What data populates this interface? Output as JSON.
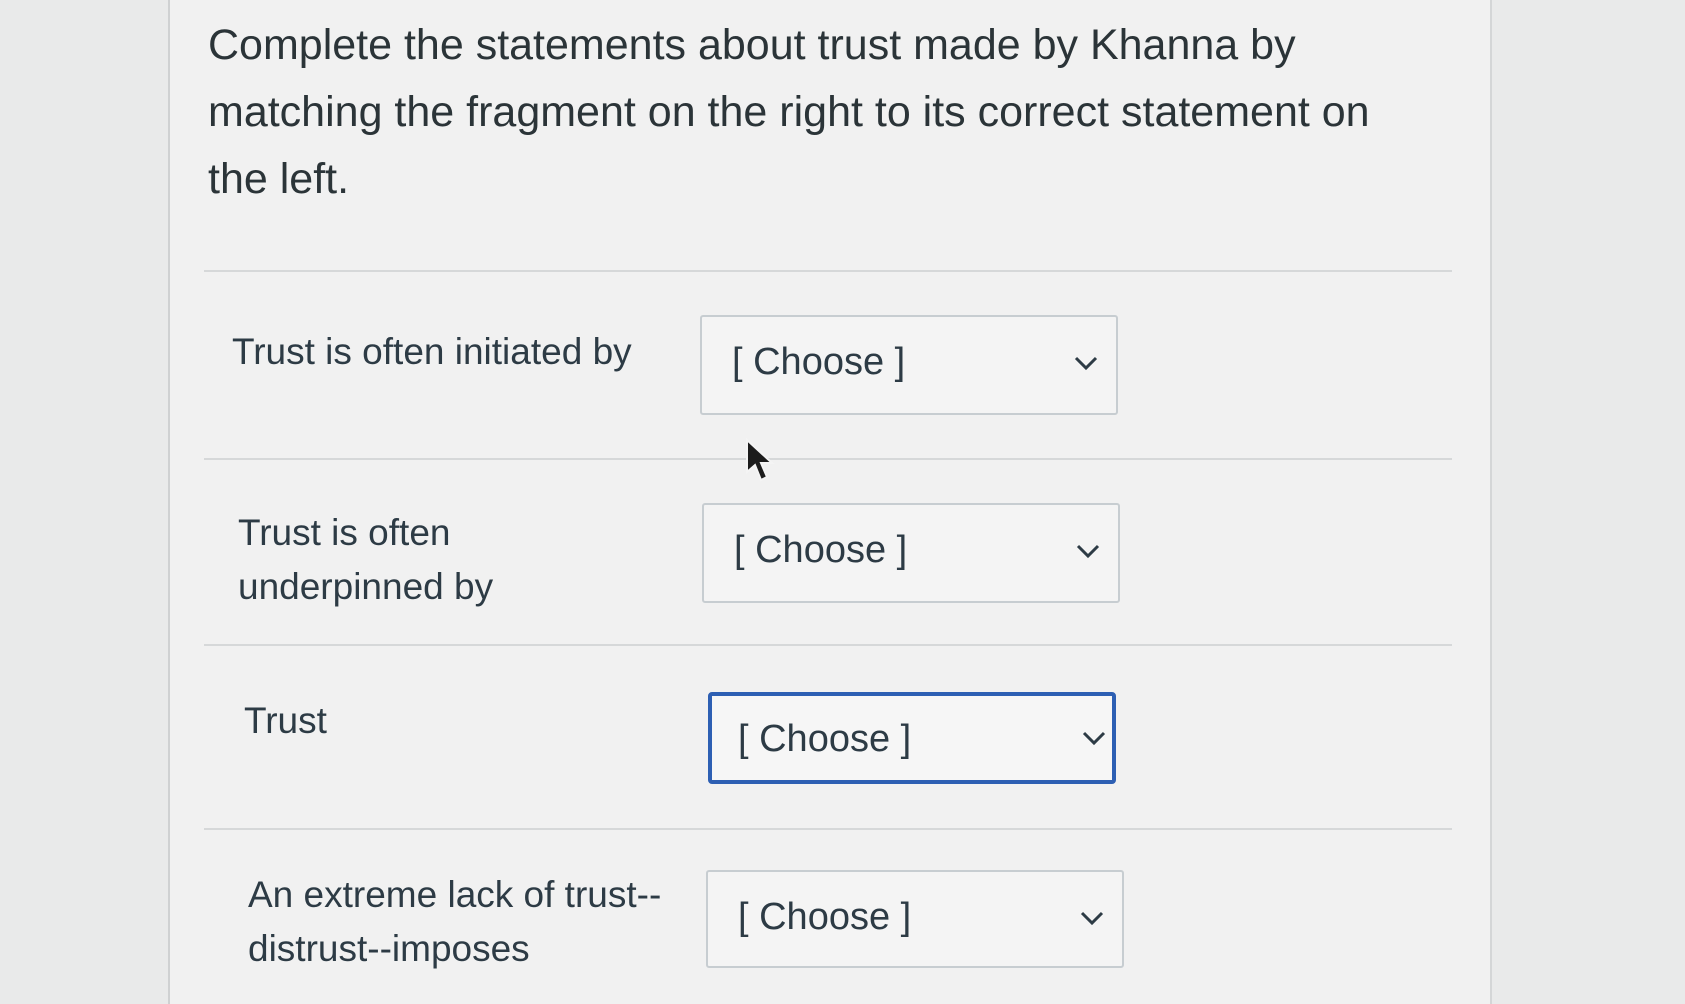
{
  "question": {
    "prompt": "Complete the statements about trust made by Khanna by matching the fragment on the right to its correct statement on the left."
  },
  "rows": [
    {
      "label": "Trust is often initiated by",
      "selected": "[ Choose ]"
    },
    {
      "label": "Trust is often underpinned by",
      "selected": "[ Choose ]"
    },
    {
      "label": "Trust",
      "selected": "[ Choose ]"
    },
    {
      "label": "An extreme lack of trust--distrust--imposes",
      "selected": "[ Choose ]"
    }
  ],
  "icons": {
    "dropdown": "chevron-down-icon",
    "pointer": "mouse-pointer-icon"
  },
  "colors": {
    "focus_border": "#2d5fb3",
    "text": "#2d3b45"
  }
}
